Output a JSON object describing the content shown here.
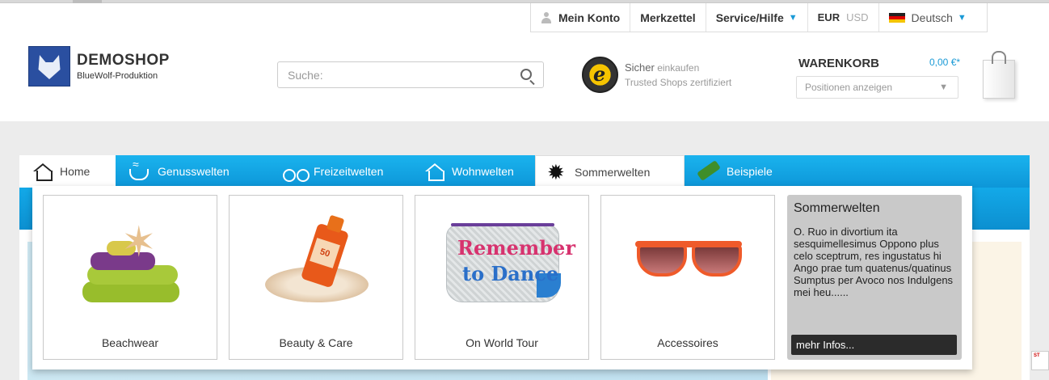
{
  "header": {
    "util_bar": {
      "account": "Mein Konto",
      "wishlist": "Merkzettel",
      "service": "Service/Hilfe",
      "currency_active": "EUR",
      "currency_other": "USD",
      "language": "Deutsch"
    },
    "logo": {
      "title": "DEMOSHOP",
      "subtitle": "BlueWolf-Produktion"
    },
    "search": {
      "placeholder": "Suche:",
      "value": ""
    },
    "trusted": {
      "line1_bold": "Sicher",
      "line1_rest": "einkaufen",
      "line2": "Trusted Shops zertifiziert",
      "seal_letter": "e"
    },
    "cart": {
      "title": "WARENKORB",
      "amount": "0,00 €*",
      "select_label": "Positionen anzeigen"
    }
  },
  "nav": {
    "items": [
      {
        "label": "Home",
        "icon": "house-icon"
      },
      {
        "label": "Genusswelten",
        "icon": "cup-icon"
      },
      {
        "label": "Freizeitwelten",
        "icon": "bike-icon"
      },
      {
        "label": "Wohnwelten",
        "icon": "house-icon"
      },
      {
        "label": "Sommerwelten",
        "icon": "sun-icon"
      },
      {
        "label": "Beispiele",
        "icon": "bottle-icon"
      }
    ]
  },
  "dropdown": {
    "cards": [
      {
        "label": "Beachwear"
      },
      {
        "label": "Beauty & Care",
        "image_text": "50"
      },
      {
        "label": "On World Tour",
        "image_text_1": "Remember",
        "image_text_2": "to Dance"
      },
      {
        "label": "Accessoires"
      }
    ],
    "info": {
      "title": "Sommerwelten",
      "text": "O. Ruo in divortium ita sesquimellesimus Oppono plus celo sceptrum, res ingustatus hi Ango prae tum quatenus/quatinus Sumptus per Avoco nos Indulgens mei heu......",
      "button": "mehr Infos..."
    }
  },
  "colors": {
    "accent": "#1a9ad6",
    "nav_blue": "#0d96d8"
  }
}
